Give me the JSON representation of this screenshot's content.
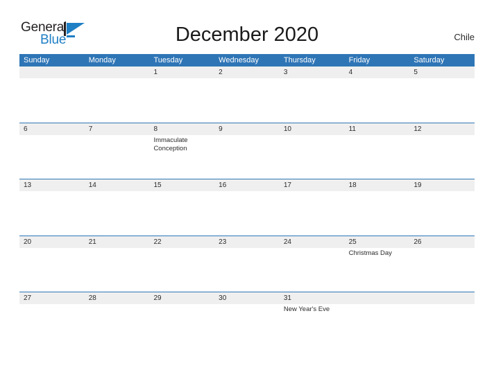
{
  "brand": {
    "name_part1": "General",
    "name_part2": "Blue",
    "mark_icon": "triangle-flag-icon",
    "accent_color": "#1f7fc4"
  },
  "header": {
    "title": "December 2020",
    "country": "Chile"
  },
  "theme": {
    "header_blue": "#2e75b6",
    "row_band_gray": "#efefef",
    "text_color": "#2b2b2b",
    "page_background": "#ffffff"
  },
  "calendar": {
    "month": "December",
    "year": "2020",
    "weekday_headers": [
      "Sunday",
      "Monday",
      "Tuesday",
      "Wednesday",
      "Thursday",
      "Friday",
      "Saturday"
    ],
    "weeks": [
      [
        {
          "number": "",
          "events": []
        },
        {
          "number": "",
          "events": []
        },
        {
          "number": "1",
          "events": []
        },
        {
          "number": "2",
          "events": []
        },
        {
          "number": "3",
          "events": []
        },
        {
          "number": "4",
          "events": []
        },
        {
          "number": "5",
          "events": []
        }
      ],
      [
        {
          "number": "6",
          "events": []
        },
        {
          "number": "7",
          "events": []
        },
        {
          "number": "8",
          "events": [
            "Immaculate Conception"
          ]
        },
        {
          "number": "9",
          "events": []
        },
        {
          "number": "10",
          "events": []
        },
        {
          "number": "11",
          "events": []
        },
        {
          "number": "12",
          "events": []
        }
      ],
      [
        {
          "number": "13",
          "events": []
        },
        {
          "number": "14",
          "events": []
        },
        {
          "number": "15",
          "events": []
        },
        {
          "number": "16",
          "events": []
        },
        {
          "number": "17",
          "events": []
        },
        {
          "number": "18",
          "events": []
        },
        {
          "number": "19",
          "events": []
        }
      ],
      [
        {
          "number": "20",
          "events": []
        },
        {
          "number": "21",
          "events": []
        },
        {
          "number": "22",
          "events": []
        },
        {
          "number": "23",
          "events": []
        },
        {
          "number": "24",
          "events": []
        },
        {
          "number": "25",
          "events": [
            "Christmas Day"
          ]
        },
        {
          "number": "26",
          "events": []
        }
      ],
      [
        {
          "number": "27",
          "events": []
        },
        {
          "number": "28",
          "events": []
        },
        {
          "number": "29",
          "events": []
        },
        {
          "number": "30",
          "events": []
        },
        {
          "number": "31",
          "events": [
            "New Year's Eve"
          ]
        },
        {
          "number": "",
          "events": []
        },
        {
          "number": "",
          "events": []
        }
      ]
    ]
  }
}
